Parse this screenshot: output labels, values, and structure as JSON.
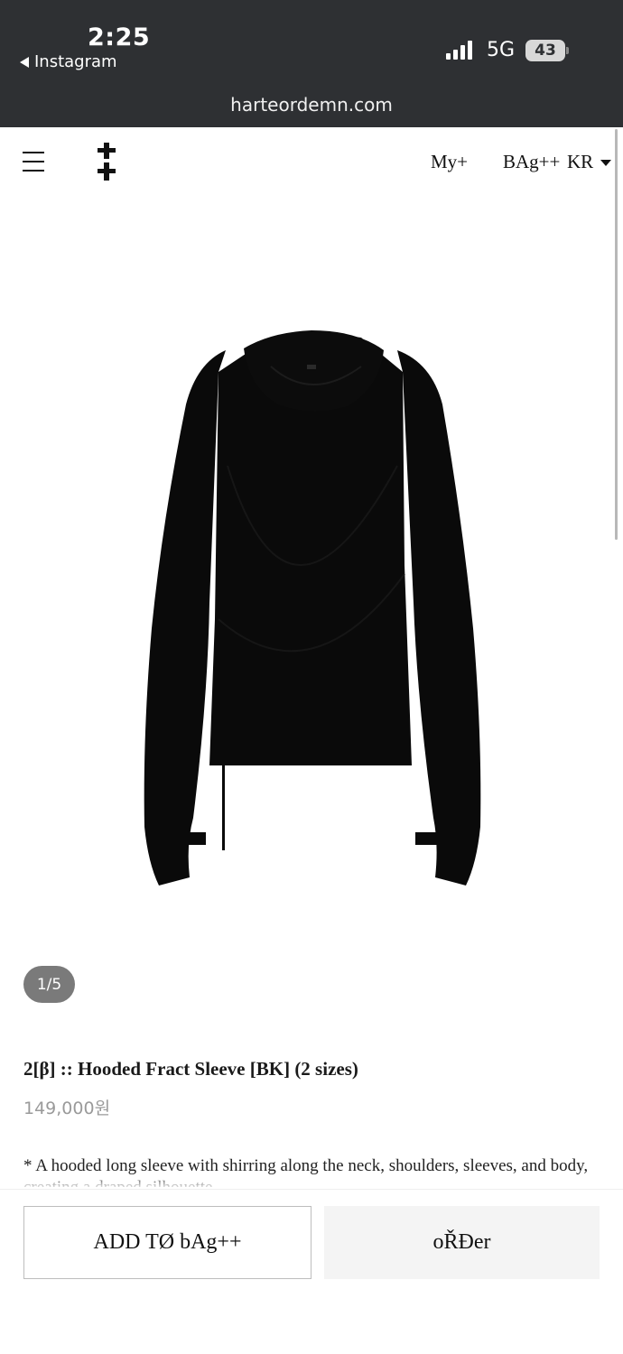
{
  "status_bar": {
    "time": "2:25",
    "back_label": "Instagram",
    "network": "5G",
    "battery": "43"
  },
  "browser": {
    "url": "harteordemn.com"
  },
  "header": {
    "nav_my": "My+",
    "nav_bag": "BAg++",
    "lang": "KR"
  },
  "gallery": {
    "pager": "1/5"
  },
  "product": {
    "title": "2[β] :: Hooded Fract Sleeve [BK] (2 sizes)",
    "price": "149,000원",
    "description": "* A hooded long sleeve with shirring along the neck, shoulders, sleeves, and body, creating a draped silhouette."
  },
  "actions": {
    "add_to_bag": "ADD TØ bAg++",
    "order": "oŘĐer"
  },
  "colors": {
    "chrome": "#2e3033",
    "garment": "#0a0a0a",
    "pager_bg": "#7a7a7a",
    "price": "#9a9a9a"
  }
}
